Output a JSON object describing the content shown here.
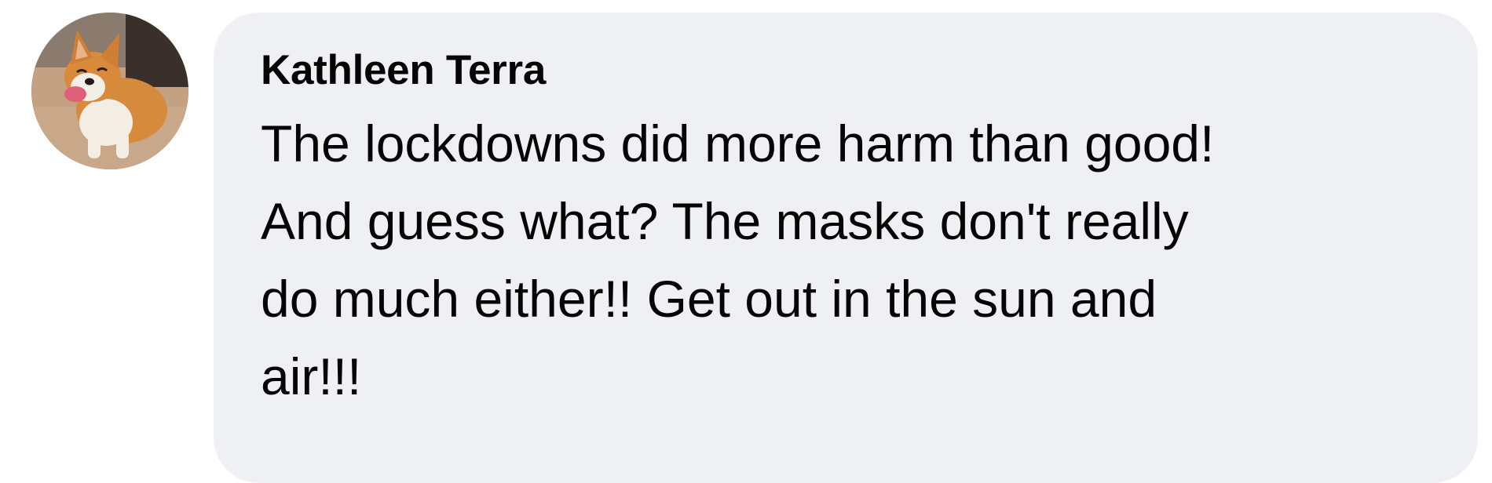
{
  "comment": {
    "author_name": "Kathleen Terra",
    "text": "The lockdowns did more harm than good!\nAnd guess what?  The masks don't really\ndo much either!!  Get out in the sun and\nair!!!",
    "avatar": {
      "icon": "corgi-dog-profile-photo"
    },
    "colors": {
      "bubble_background": "#eff0f4",
      "text": "#050505"
    }
  }
}
